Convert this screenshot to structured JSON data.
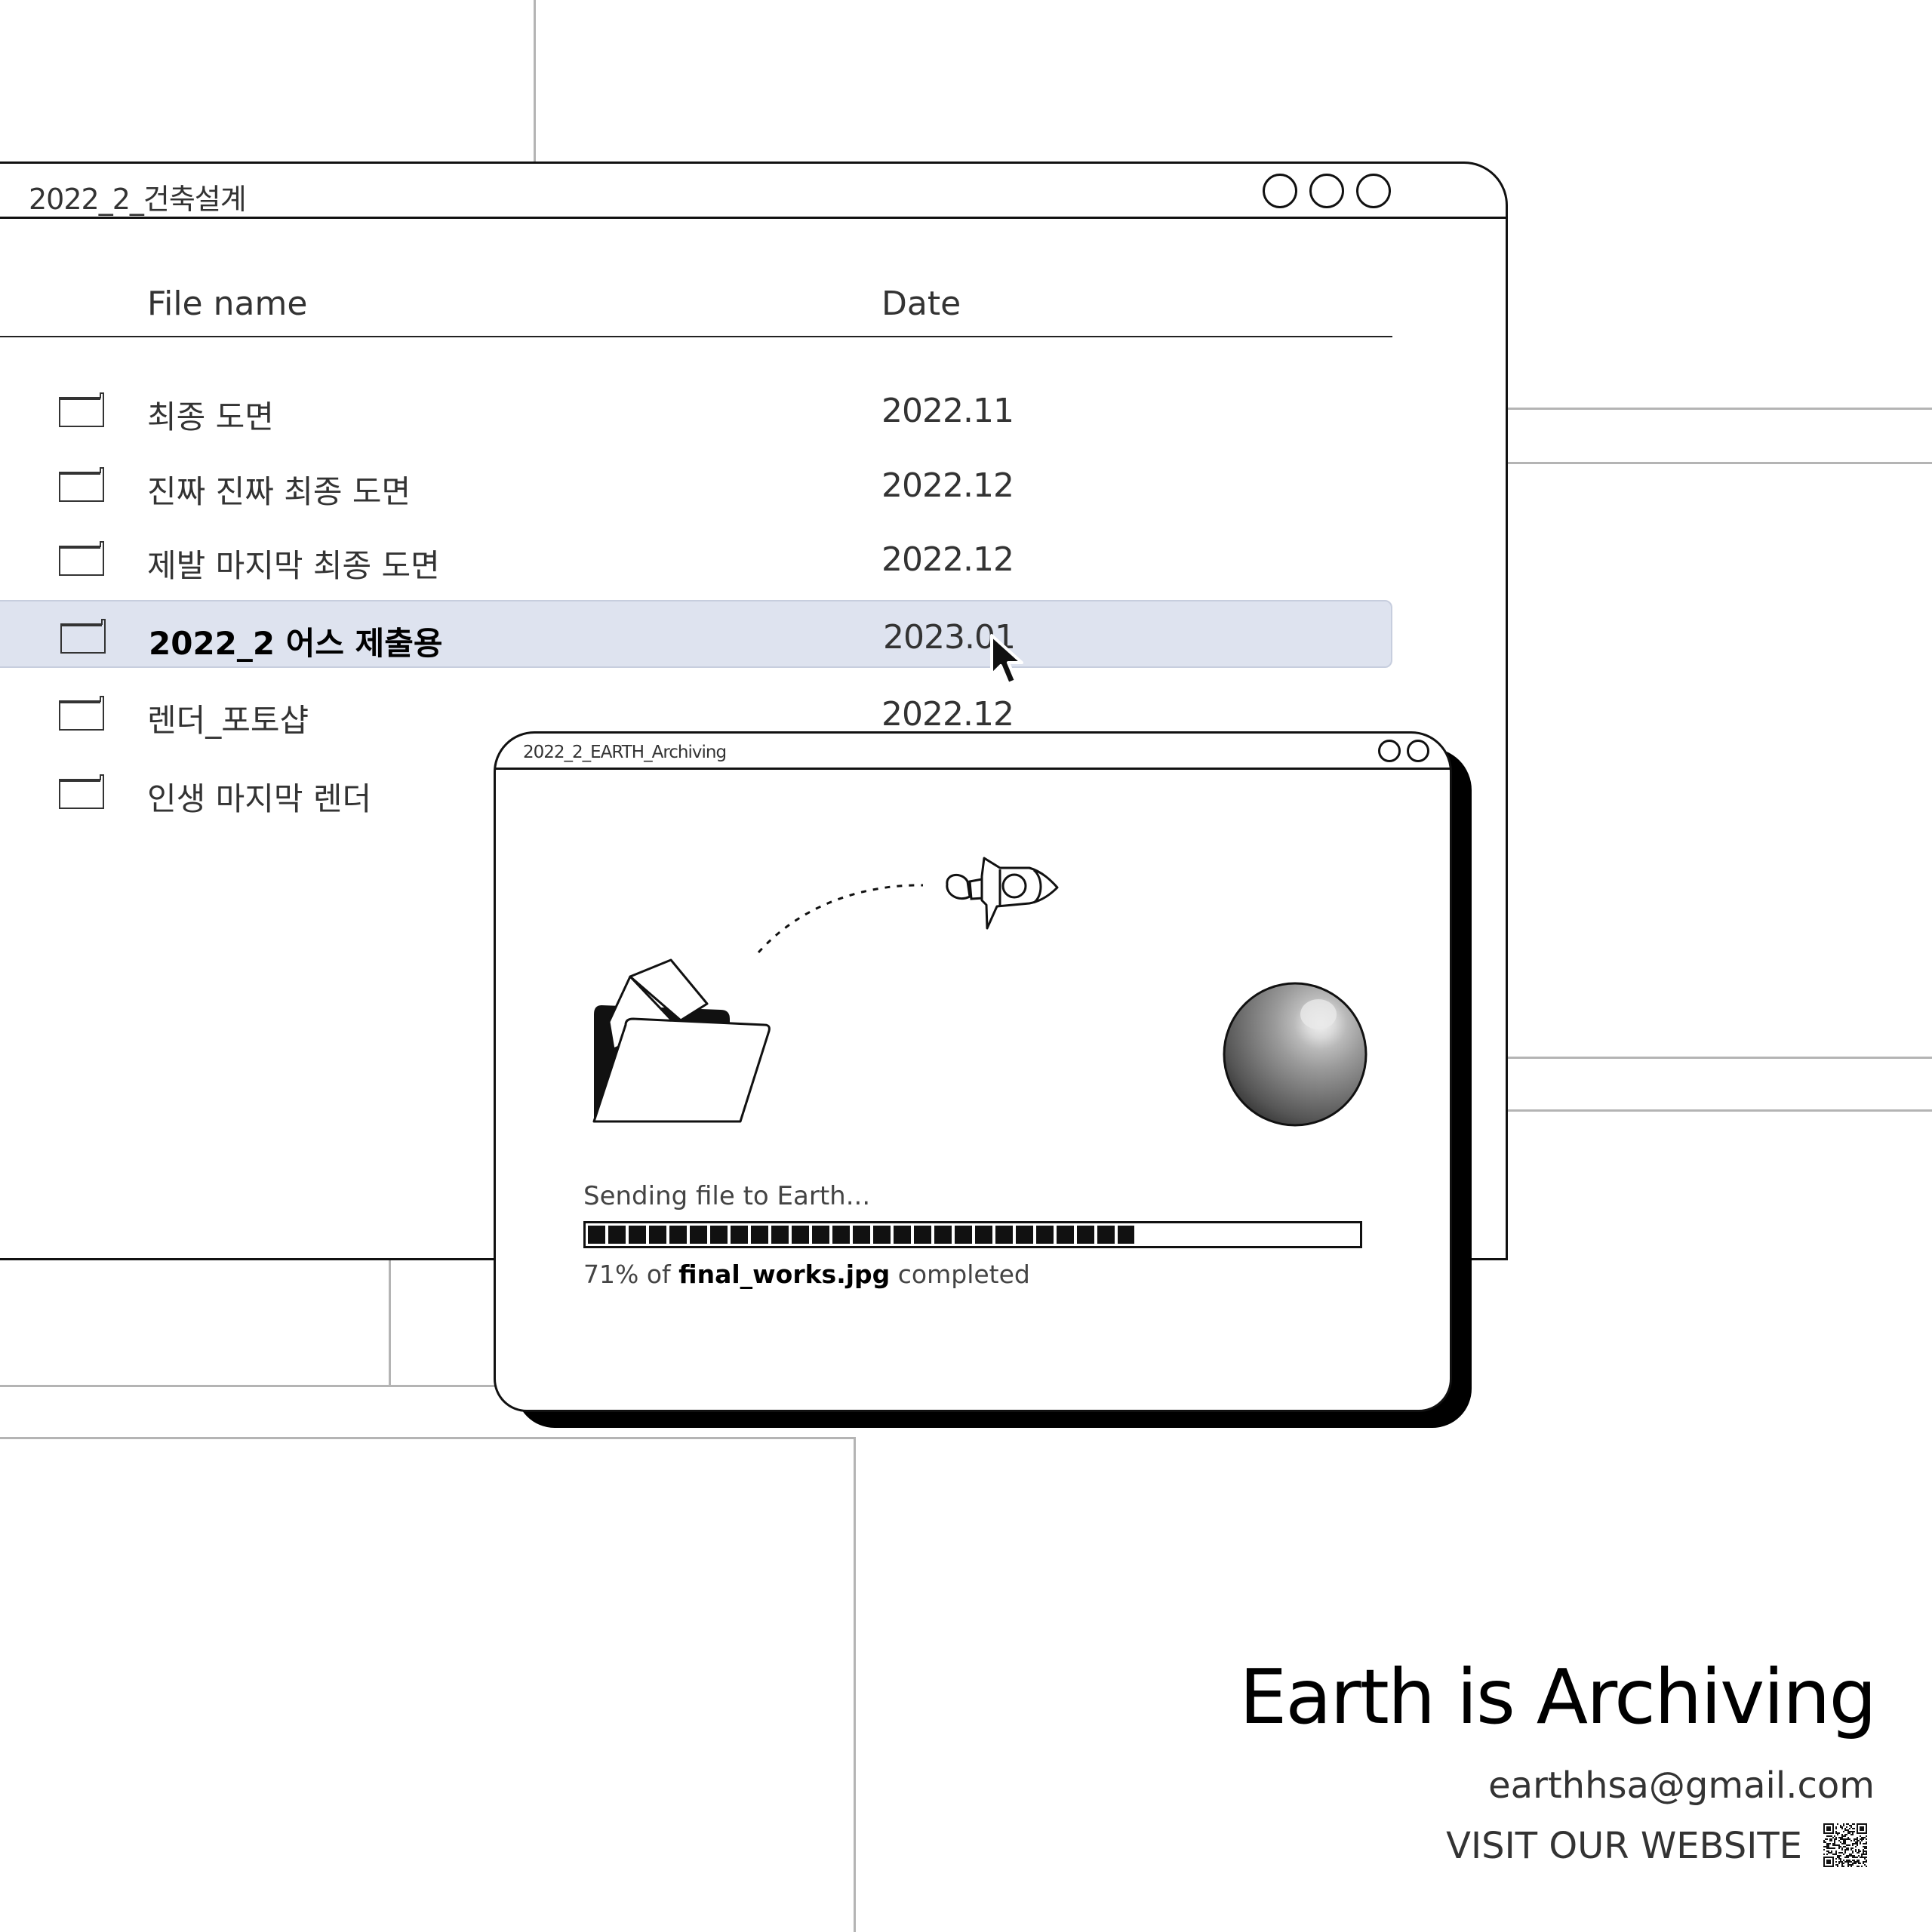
{
  "main_window": {
    "title": "2022_2_건축설계",
    "columns": {
      "name": "File name",
      "date": "Date"
    },
    "files": [
      {
        "name": "최종 도면",
        "date": "2022.11",
        "selected": false
      },
      {
        "name": "진짜 진짜 최종 도면",
        "date": "2022.12",
        "selected": false
      },
      {
        "name": "제발 마지막 최종 도면",
        "date": "2022.12",
        "selected": false
      },
      {
        "name": "2022_2 어스 제출용",
        "date": "2023.01",
        "selected": true
      },
      {
        "name": "렌더_포토샵",
        "date": "2022.12",
        "selected": false
      },
      {
        "name": "인생 마지막 렌더",
        "date": "",
        "selected": false
      }
    ]
  },
  "dialog": {
    "title": "2022_2_EARTH_Archiving",
    "status": "Sending file to Earth...",
    "progress_percent": 71,
    "caption": {
      "prefix": "71% of ",
      "filename": "final_works.jpg",
      "suffix": " completed"
    }
  },
  "brand": {
    "title": "Earth is Archiving",
    "email": "earthhsa@gmail.com",
    "visit": "VISIT OUR WEBSITE"
  },
  "icons": {
    "folder": "folder-icon",
    "cursor": "cursor-icon",
    "rocket": "rocket-icon",
    "planet": "planet-icon",
    "open_folder": "open-folder-icon",
    "qr": "qr-code-icon"
  }
}
